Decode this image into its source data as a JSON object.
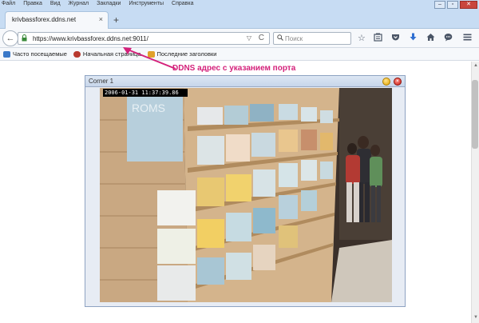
{
  "menu": {
    "items": [
      "Файл",
      "Правка",
      "Вид",
      "Журнал",
      "Закладки",
      "Инструменты",
      "Справка"
    ]
  },
  "window_controls": {
    "minimize": "–",
    "maximize": "▫",
    "close": "✕"
  },
  "tab": {
    "title": "krivbassforex.ddns.net",
    "close": "×",
    "new_tab": "+"
  },
  "navbar": {
    "url": "https://www.krivbassforex.ddns.net:9011/",
    "search_placeholder": "Поиск",
    "back_glyph": "←",
    "reload_glyph": "C",
    "drop_glyph": "▽",
    "toolbar_icons": [
      "star-icon",
      "reading-list-icon",
      "pocket-icon",
      "download-icon",
      "home-icon",
      "chat-icon",
      "menu-icon"
    ]
  },
  "bookmarks": {
    "items": [
      {
        "label": "Часто посещаемые",
        "color": "#3a78c8"
      },
      {
        "label": "Начальная страница",
        "color": "#b8392f"
      },
      {
        "label": "Последние заголовки",
        "color": "#e0a02a"
      }
    ]
  },
  "annotation": {
    "text": "DDNS адрес с указанием порта",
    "color": "#d4207a"
  },
  "camera": {
    "title": "Corner 1",
    "timestamp": "2006-01-31  11:37:39.86"
  }
}
